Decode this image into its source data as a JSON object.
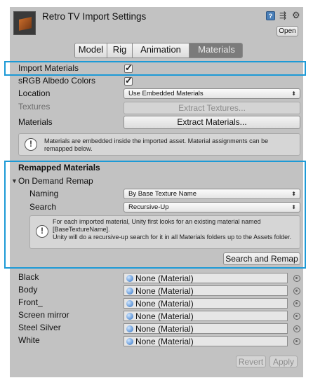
{
  "header": {
    "title": "Retro TV Import Settings",
    "open_label": "Open",
    "icons": [
      "help-book-icon",
      "preset-sliders-icon",
      "settings-gear-icon"
    ]
  },
  "tabs": [
    {
      "label": "Model",
      "active": false
    },
    {
      "label": "Rig",
      "active": false
    },
    {
      "label": "Animation",
      "active": false
    },
    {
      "label": "Materials",
      "active": true
    }
  ],
  "materials": {
    "import_materials_label": "Import Materials",
    "import_materials_checked": true,
    "srgb_label": "sRGB Albedo Colors",
    "srgb_checked": true,
    "location_label": "Location",
    "location_value": "Use Embedded Materials",
    "textures_label": "Textures",
    "extract_textures_label": "Extract Textures...",
    "materials_label": "Materials",
    "extract_materials_label": "Extract Materials...",
    "info_text": "Materials are embedded inside the imported asset. Material assignments can be remapped below."
  },
  "remapped": {
    "heading": "Remapped Materials",
    "on_demand_label": "On Demand Remap",
    "naming_label": "Naming",
    "naming_value": "By Base Texture Name",
    "search_label": "Search",
    "search_value": "Recursive-Up",
    "info_line1": "For each imported material, Unity first looks for an existing material named [BaseTextureName].",
    "info_line2": "Unity will do a recursive-up search for it in all Materials folders up to the Assets folder.",
    "search_remap_label": "Search and Remap"
  },
  "slots": [
    {
      "name": "Black",
      "value": "None (Material)"
    },
    {
      "name": "Body",
      "value": "None (Material)"
    },
    {
      "name": "Front_",
      "value": "None (Material)"
    },
    {
      "name": "Screen mirror",
      "value": "None (Material)"
    },
    {
      "name": "Steel Silver",
      "value": "None (Material)"
    },
    {
      "name": "White",
      "value": "None (Material)"
    }
  ],
  "footer": {
    "revert_label": "Revert",
    "apply_label": "Apply"
  },
  "colors": {
    "panel_bg": "#c2c2c2",
    "highlight": "#1d9ad6",
    "active_tab": "#7b7b7b",
    "material_ball": "#2b6fc4"
  }
}
